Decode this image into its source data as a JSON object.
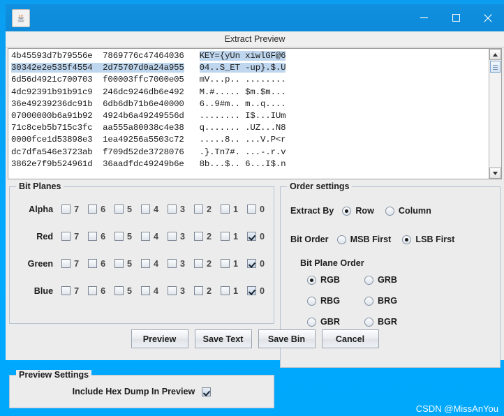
{
  "window": {
    "app_icon": "java-coffee-cup-icon",
    "minimize_label": "Minimize",
    "maximize_label": "Maximize",
    "close_label": "Close",
    "dialog_title": "Extract Preview"
  },
  "preview": {
    "lines": [
      {
        "hex1": "4b45593d7b79556e",
        "hex2": "7869776c47464036",
        "ascii": "KEY={yUn xiwlGF@6",
        "hex_selected": false,
        "ascii_selected": true
      },
      {
        "hex1": "30342e2e535f4554",
        "hex2": "2d75707d0a24a955",
        "ascii": "04..S_ET -up}.$.U",
        "hex_selected": true,
        "ascii_selected": true
      },
      {
        "hex1": "6d56d4921c700703",
        "hex2": "f00003ffc7000e05",
        "ascii": "mV...p.. ........",
        "hex_selected": false,
        "ascii_selected": false
      },
      {
        "hex1": "4dc92391b91b91c9",
        "hex2": "246dc9246db6e492",
        "ascii": "M.#..... $m.$m...",
        "hex_selected": false,
        "ascii_selected": false
      },
      {
        "hex1": "36e49239236dc91b",
        "hex2": "6db6db71b6e40000",
        "ascii": "6..9#m.. m..q....",
        "hex_selected": false,
        "ascii_selected": false
      },
      {
        "hex1": "07000000b6a91b92",
        "hex2": "4924b6a49249556d",
        "ascii": "........ I$...IUm",
        "hex_selected": false,
        "ascii_selected": false
      },
      {
        "hex1": "71c8ceb5b715c3fc",
        "hex2": "aa555a80038c4e38",
        "ascii": "q....... .UZ...N8",
        "hex_selected": false,
        "ascii_selected": false
      },
      {
        "hex1": "0000fce1d53898e3",
        "hex2": "1ea49256a5503c72",
        "ascii": ".....8.. ...V.P<r",
        "hex_selected": false,
        "ascii_selected": false
      },
      {
        "hex1": "dc7dfa546e3723ab",
        "hex2": "f709d52de3728076",
        "ascii": ".}.Tn7#. ...-.r.v",
        "hex_selected": false,
        "ascii_selected": false
      },
      {
        "hex1": "3862e7f9b524961d",
        "hex2": "36aadfdc49249b6e",
        "ascii": "8b...$.. 6...I$.n",
        "hex_selected": false,
        "ascii_selected": false
      }
    ],
    "scrollbar": {
      "up_icon": "triangle-up-icon",
      "down_icon": "triangle-down-icon"
    }
  },
  "bit_planes": {
    "legend": "Bit Planes",
    "bit_labels": [
      "7",
      "6",
      "5",
      "4",
      "3",
      "2",
      "1",
      "0"
    ],
    "rows": [
      {
        "channel": "Alpha",
        "checked": [
          false,
          false,
          false,
          false,
          false,
          false,
          false,
          false
        ]
      },
      {
        "channel": "Red",
        "checked": [
          false,
          false,
          false,
          false,
          false,
          false,
          false,
          true
        ]
      },
      {
        "channel": "Green",
        "checked": [
          false,
          false,
          false,
          false,
          false,
          false,
          false,
          true
        ]
      },
      {
        "channel": "Blue",
        "checked": [
          false,
          false,
          false,
          false,
          false,
          false,
          false,
          true
        ]
      }
    ]
  },
  "preview_settings": {
    "legend": "Preview Settings",
    "hex_dump_label": "Include Hex Dump In Preview",
    "hex_dump_checked": true
  },
  "order_settings": {
    "legend": "Order settings",
    "extract_by": {
      "label": "Extract By",
      "options": [
        {
          "label": "Row",
          "selected": true
        },
        {
          "label": "Column",
          "selected": false
        }
      ]
    },
    "bit_order": {
      "label": "Bit Order",
      "options": [
        {
          "label": "MSB First",
          "selected": false
        },
        {
          "label": "LSB First",
          "selected": true
        }
      ]
    },
    "bit_plane_order": {
      "label": "Bit Plane Order",
      "options": [
        {
          "label": "RGB",
          "selected": true
        },
        {
          "label": "GRB",
          "selected": false
        },
        {
          "label": "RBG",
          "selected": false
        },
        {
          "label": "BRG",
          "selected": false
        },
        {
          "label": "GBR",
          "selected": false
        },
        {
          "label": "BGR",
          "selected": false
        }
      ]
    }
  },
  "buttons": [
    {
      "label": "Preview",
      "name": "preview-button"
    },
    {
      "label": "Save Text",
      "name": "save-text-button"
    },
    {
      "label": "Save Bin",
      "name": "save-bin-button"
    },
    {
      "label": "Cancel",
      "name": "cancel-button"
    }
  ],
  "watermark": "CSDN @MissAnYou",
  "colors": {
    "titlebar": "#0d8ad9",
    "desktop": "#00aaff",
    "dialog_bg": "#ececec",
    "selection": "#bed6ee"
  }
}
